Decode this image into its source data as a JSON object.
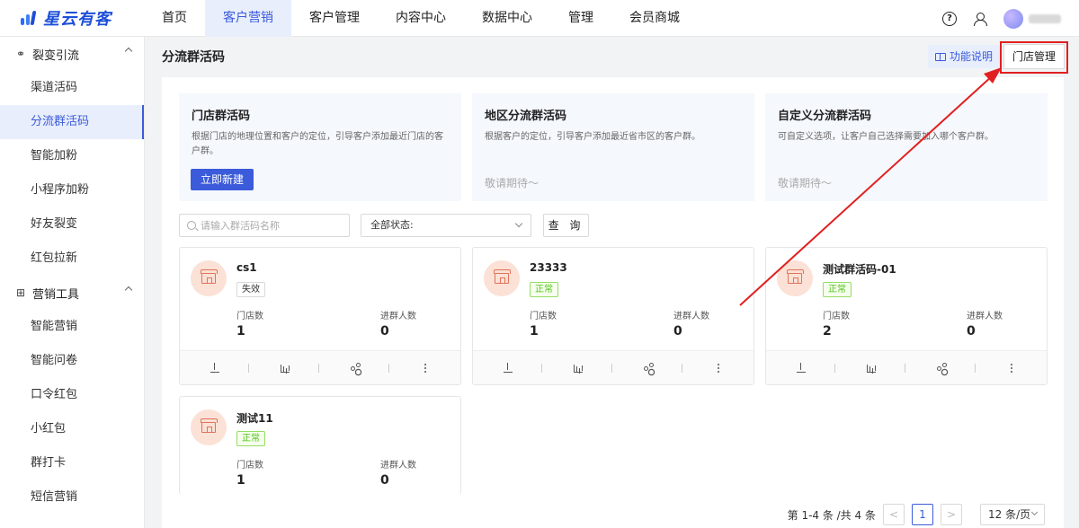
{
  "brand": {
    "name": "星云有客"
  },
  "nav": {
    "items": [
      {
        "label": "首页"
      },
      {
        "label": "客户营销"
      },
      {
        "label": "客户管理"
      },
      {
        "label": "内容中心"
      },
      {
        "label": "数据中心"
      },
      {
        "label": "管理"
      },
      {
        "label": "会员商城"
      }
    ],
    "active_index": 1,
    "help_icon_glyph": "?"
  },
  "sidebar": {
    "groups": [
      {
        "label": "裂变引流",
        "icon": "fission-icon",
        "items": [
          "渠道活码",
          "分流群活码",
          "智能加粉",
          "小程序加粉",
          "好友裂变",
          "红包拉新"
        ]
      },
      {
        "label": "营销工具",
        "icon": "gift-icon",
        "items": [
          "智能营销",
          "智能问卷",
          "口令红包",
          "小红包",
          "群打卡",
          "短信营销"
        ]
      }
    ],
    "active_item": "分流群活码"
  },
  "page": {
    "title": "分流群活码",
    "help_label": "功能说明",
    "store_manage_label": "门店管理"
  },
  "types": [
    {
      "title": "门店群活码",
      "desc": "根据门店的地理位置和客户的定位，引导客户添加最近门店的客户群。",
      "action": "立即新建"
    },
    {
      "title": "地区分流群活码",
      "desc": "根据客户的定位，引导客户添加最近省市区的客户群。",
      "soon": "敬请期待～"
    },
    {
      "title": "自定义分流群活码",
      "desc": "可自定义选项，让客户自己选择需要加入哪个客户群。",
      "soon": "敬请期待～"
    }
  ],
  "filters": {
    "search_placeholder": "请输入群活码名称",
    "status_value": "全部状态:",
    "query_label": "查 询"
  },
  "stat_labels": {
    "stores": "门店数",
    "joined": "进群人数"
  },
  "cards": [
    {
      "name": "cs1",
      "status": "失效",
      "status_type": "bad",
      "stores": "1",
      "joined": "0"
    },
    {
      "name": "23333",
      "status": "正常",
      "status_type": "ok",
      "stores": "1",
      "joined": "0"
    },
    {
      "name": "测试群活码-01",
      "status": "正常",
      "status_type": "ok",
      "stores": "2",
      "joined": "0"
    },
    {
      "name": "测试11",
      "status": "正常",
      "status_type": "ok",
      "stores": "1",
      "joined": "0"
    }
  ],
  "pagination": {
    "summary": "第 1-4 条 /共 4 条",
    "prev": "<",
    "current": "1",
    "next": ">",
    "page_size": "12 条/页"
  },
  "colors": {
    "accent": "#3b5bdb",
    "annotation": "#e02020",
    "ok": "#52c41a"
  }
}
